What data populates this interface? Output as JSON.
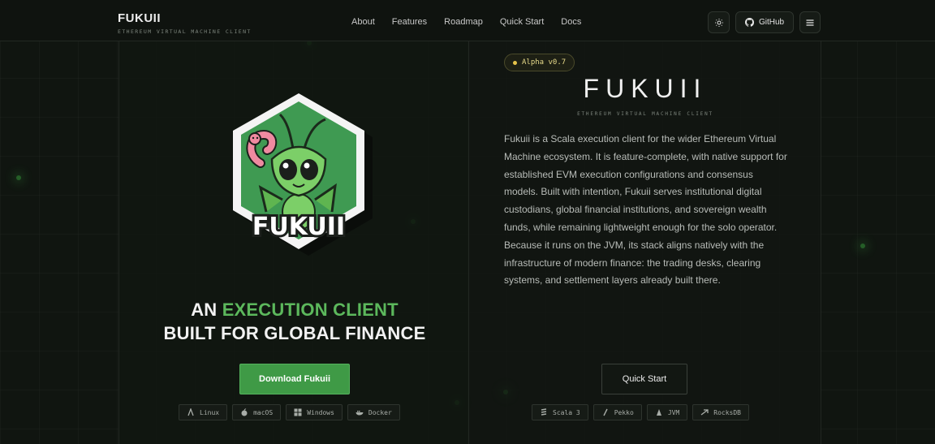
{
  "header": {
    "brand": "FUKUII",
    "brand_sub": "ETHEREUM VIRTUAL MACHINE CLIENT",
    "nav": [
      "About",
      "Features",
      "Roadmap",
      "Quick Start",
      "Docs"
    ],
    "github_label": "GitHub",
    "icons": {
      "theme": "sun-icon",
      "github": "github-icon",
      "menu": "hamburger-menu-icon"
    }
  },
  "hero": {
    "logo_text": "FUKUII",
    "headline_prefix": "AN ",
    "headline_green": "EXECUTION CLIENT",
    "headline_line2": "BUILT FOR GLOBAL FINANCE",
    "download_label": "Download Fukuii",
    "platforms": [
      "Linux",
      "macOS",
      "Windows",
      "Docker"
    ]
  },
  "about": {
    "badge": "Alpha v0.7",
    "title": "FUKUII",
    "subtitle": "ETHEREUM VIRTUAL MACHINE CLIENT",
    "description": "Fukuii is a Scala execution client for the wider Ethereum Virtual Machine ecosystem. It is feature-complete, with native support for established EVM execution configurations and consensus models. Built with intention, Fukuii serves institutional digital custodians, global financial institutions, and sovereign wealth funds, while remaining lightweight enough for the solo operator. Because it runs on the JVM, its stack aligns natively with the infrastructure of modern finance: the trading desks, clearing systems, and settlement layers already built there.",
    "quick_start_label": "Quick Start",
    "tech": [
      "Scala 3",
      "Pekko",
      "JVM",
      "RocksDB"
    ]
  },
  "colors": {
    "accent": "#3f9a46",
    "accent_text": "#5cb85c",
    "badge_text": "#e6d98a",
    "background": "#101510"
  }
}
